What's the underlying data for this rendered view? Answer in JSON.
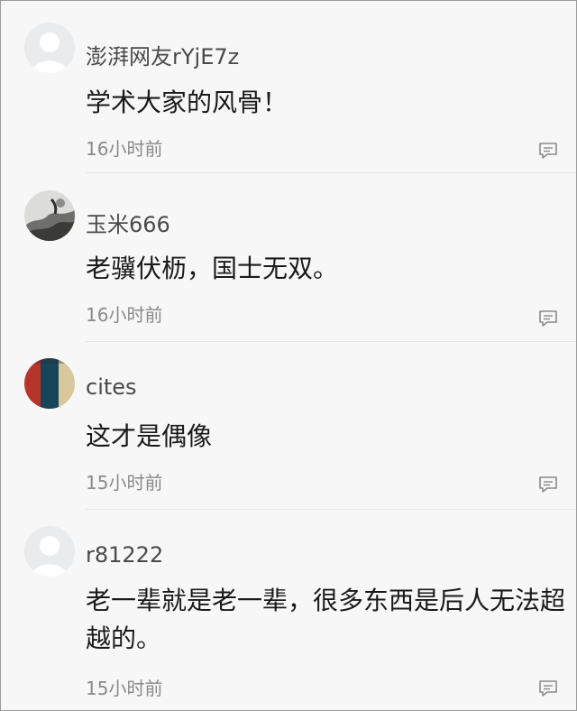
{
  "comments": [
    {
      "username": "澎湃网友rYjE7z",
      "content": "学术大家的风骨！",
      "time": "16小时前",
      "avatar": "default-avatar",
      "reply_icon": "reply-icon"
    },
    {
      "username": "玉米666",
      "content": "老骥伏枥，国士无双。",
      "time": "16小时前",
      "avatar": "ink-landscape-avatar",
      "reply_icon": "reply-icon"
    },
    {
      "username": "cites",
      "content": "这才是偶像",
      "time": "15小时前",
      "avatar": "color-stripes-avatar",
      "reply_icon": "reply-icon"
    },
    {
      "username": "r81222",
      "content": "老一辈就是老一辈，很多东西是后人无法超越的。",
      "time": "15小时前",
      "avatar": "default-avatar",
      "reply_icon": "reply-icon"
    }
  ],
  "colors": {
    "background": "#f7f7f7",
    "username": "#4a4a4a",
    "content": "#1a1a1a",
    "time": "#8a8a8a",
    "icon": "#8a8a8a"
  }
}
